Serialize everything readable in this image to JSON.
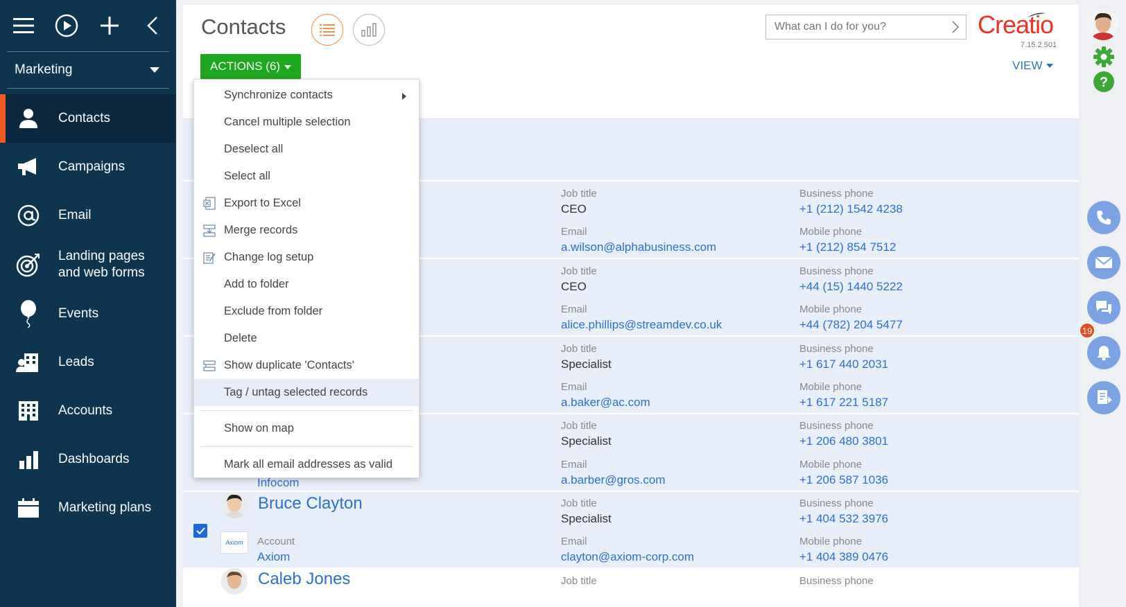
{
  "sidebar": {
    "workplace": "Marketing",
    "items": [
      {
        "label": "Contacts",
        "icon": "person-icon",
        "active": true
      },
      {
        "label": "Campaigns",
        "icon": "megaphone-icon"
      },
      {
        "label": "Email",
        "icon": "at-icon"
      },
      {
        "label_line1": "Landing pages",
        "label_line2": "and web forms",
        "icon": "target-icon"
      },
      {
        "label": "Events",
        "icon": "balloon-icon"
      },
      {
        "label": "Leads",
        "icon": "leads-icon"
      },
      {
        "label": "Accounts",
        "icon": "building-icon"
      },
      {
        "label": "Dashboards",
        "icon": "bar-chart-icon"
      },
      {
        "label": "Marketing plans",
        "icon": "calendar-icon"
      }
    ]
  },
  "header": {
    "title": "Contacts",
    "actions_label": "ACTIONS (6)",
    "search_placeholder": "What can I do for you?",
    "logo": "Creatio",
    "version": "7.15.2.501",
    "view_label": "VIEW"
  },
  "menu": {
    "items": [
      "Synchronize contacts",
      "Cancel multiple selection",
      "Deselect all",
      "Select all",
      "Export to Excel",
      "Merge records",
      "Change log setup",
      "Add to folder",
      "Exclude from folder",
      "Delete",
      "Show duplicate 'Contacts'",
      "Tag / untag selected records",
      "Show on map",
      "Mark all email addresses as valid"
    ]
  },
  "labels": {
    "job_title": "Job title",
    "email": "Email",
    "business_phone": "Business phone",
    "mobile_phone": "Mobile phone",
    "account": "Account"
  },
  "rows": [
    {
      "job": "CEO",
      "email": "a.wilson@alphabusiness.com",
      "bphone": "+1 (212) 1542 4238",
      "mphone": "+1 (212) 854 7512"
    },
    {
      "job": "CEO",
      "email": "alice.phillips@streamdev.co.uk",
      "bphone": "+44 (15) 1440 5222",
      "mphone": "+44 (782) 204 5477"
    },
    {
      "job": "Specialist",
      "email": "a.baker@ac.com",
      "bphone": "+1 617 440 2031",
      "mphone": "+1 617 221 5187"
    },
    {
      "job": "Specialist",
      "email": "a.barber@gros.com",
      "bphone": "+1 206 480 3801",
      "mphone": "+1 206 587 1036",
      "account": "Infocom"
    },
    {
      "name": "Bruce Clayton",
      "job": "Specialist",
      "email": "clayton@axiom-corp.com",
      "bphone": "+1 404 532 3976",
      "mphone": "+1 404 389 0476",
      "account": "Axiom",
      "account_logo": "Axiom"
    },
    {
      "name": "Caleb Jones"
    }
  ],
  "rail": {
    "notification_count": "19"
  },
  "colors": {
    "sidebar_bg": "#0e3550",
    "accent_orange": "#f15a24",
    "actions_green": "#1ea81e",
    "link_blue": "#2b6fd1",
    "selected_row": "#e8eefa"
  }
}
